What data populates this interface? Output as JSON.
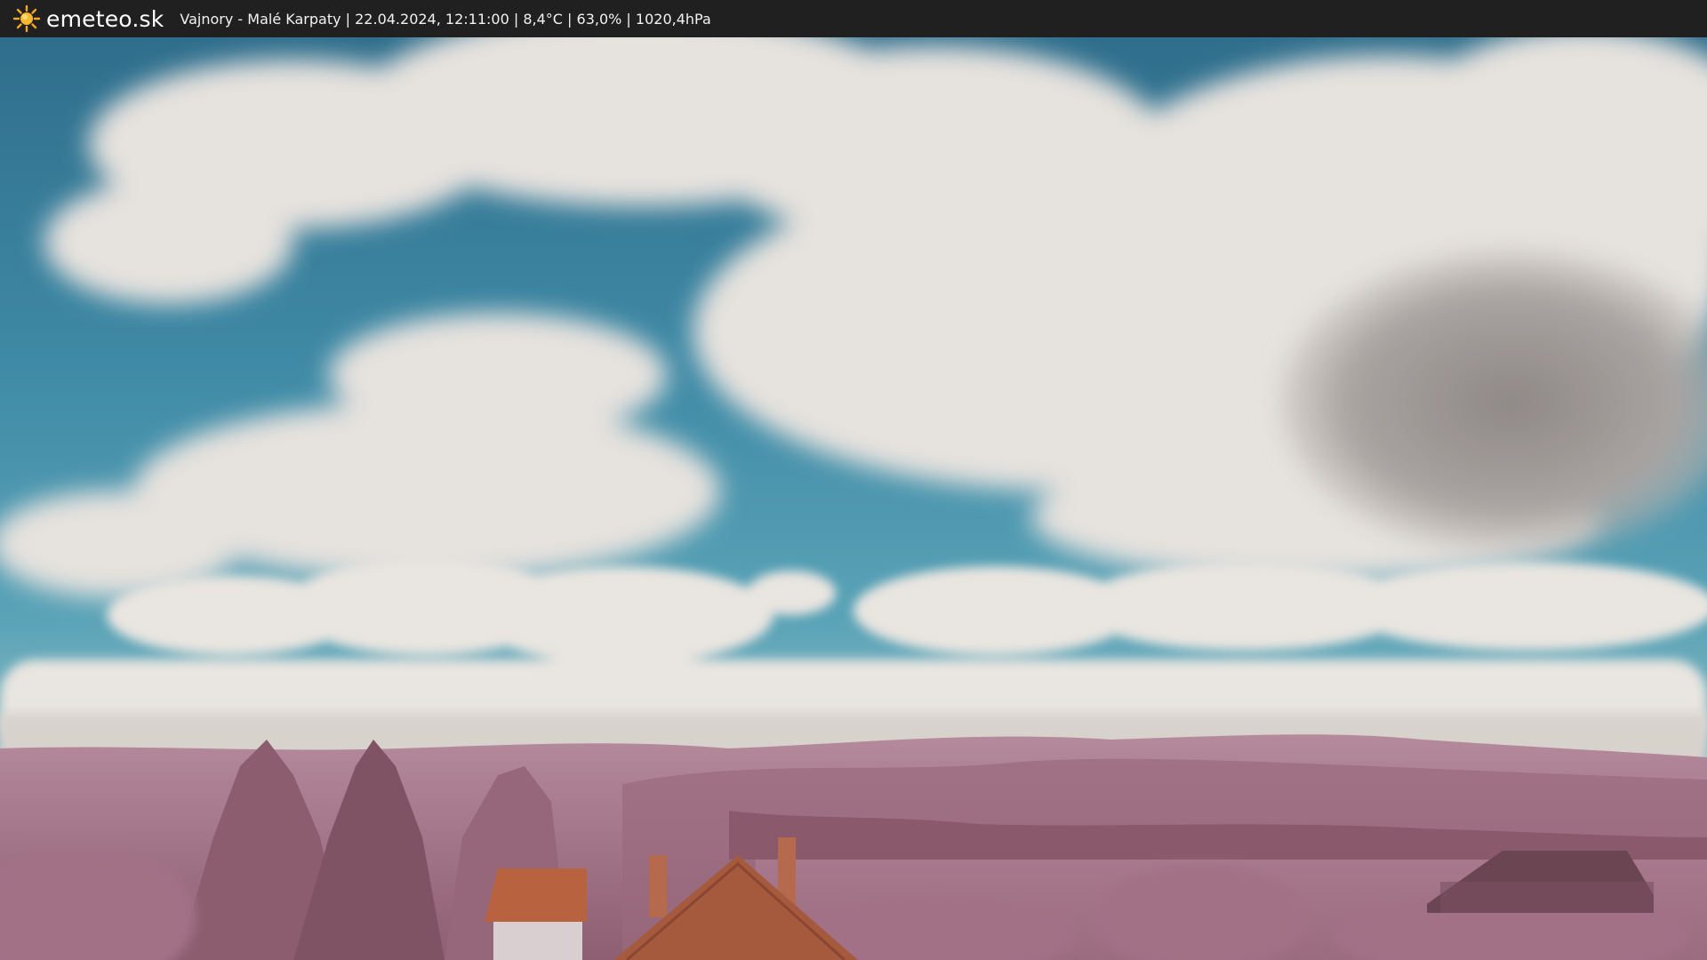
{
  "header": {
    "brand": "emeteo.sk",
    "caption": "Vajnory - Malé Karpaty | 22.04.2024, 12:11:00 | 8,4°C | 63,0% | 1020,4hPa",
    "logo_icon": "sun-icon"
  },
  "colors": {
    "bar_background": "#202020",
    "sky_blue": "#3f8aa6",
    "cloud_white": "#ebe7e2",
    "foliage_pink": "#b78296",
    "roof_orange": "#b9623f"
  }
}
